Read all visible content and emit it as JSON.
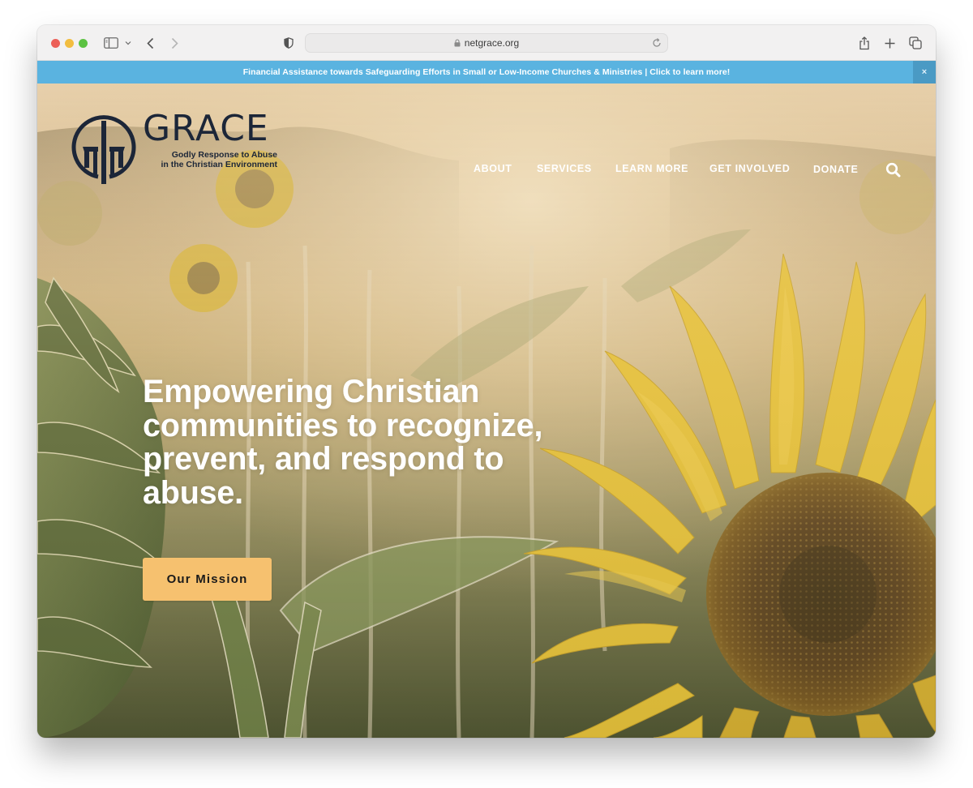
{
  "browser": {
    "url": "netgrace.org",
    "icons": {
      "sidebar": "sidebar-icon",
      "sidebar_menu": "chevron-down-icon",
      "back": "chevron-left-icon",
      "forward": "chevron-right-icon",
      "privacy": "shield-icon",
      "lock": "lock-icon",
      "reload": "reload-icon",
      "share": "share-icon",
      "new_tab": "plus-icon",
      "tab_overview": "tabs-icon"
    }
  },
  "announcement": {
    "text": "Financial Assistance towards Safeguarding Efforts in Small or Low-Income Churches & Ministries | Click to learn more!",
    "close_label": "×",
    "background": "#5ab3e0"
  },
  "site": {
    "logo": {
      "wordmark": "GRACE",
      "tagline_line1": "Godly Response to Abuse",
      "tagline_line2": "in the Christian Environment",
      "color": "#1c2638"
    },
    "nav": {
      "items": [
        {
          "label": "ABOUT"
        },
        {
          "label": "SERVICES"
        },
        {
          "label": "LEARN MORE"
        },
        {
          "label": "GET INVOLVED"
        },
        {
          "label": "DONATE"
        }
      ],
      "search_icon": "search-icon"
    },
    "hero": {
      "headline": "Empowering Christian communities to recognize, prevent, and respond to abuse.",
      "cta_label": "Our Mission",
      "cta_color": "#f6c16f",
      "background_image": "sunflower field"
    }
  }
}
